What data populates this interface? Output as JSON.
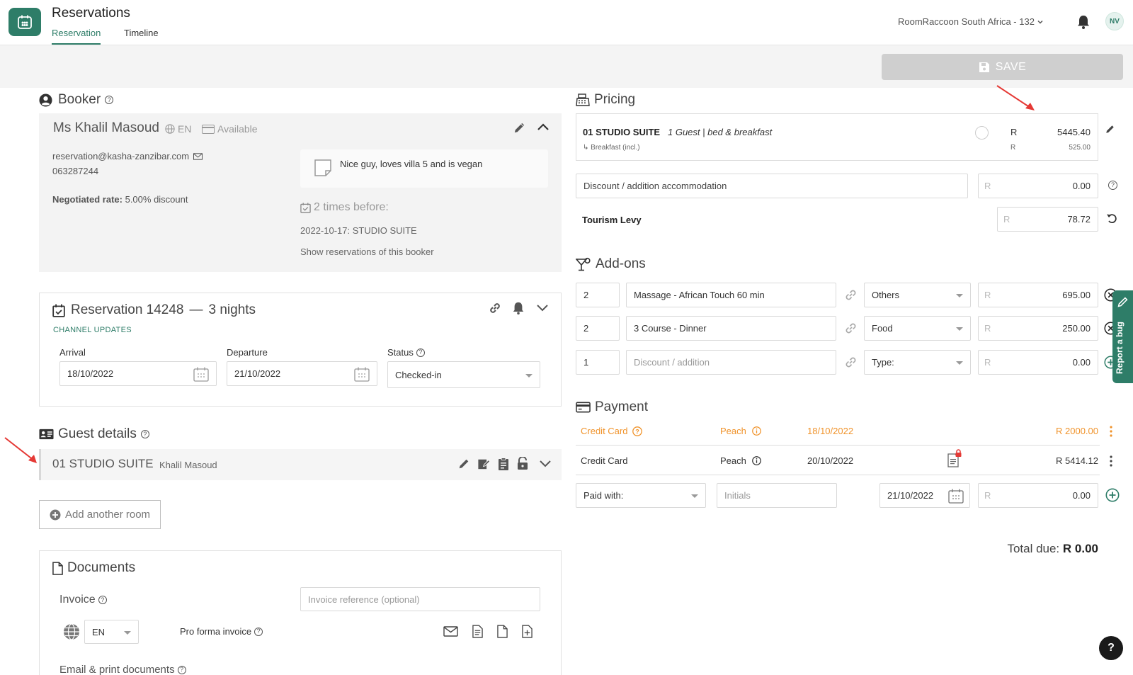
{
  "header": {
    "app_title": "Reservations",
    "tabs": [
      "Reservation",
      "Timeline"
    ],
    "property": "RoomRaccoon South Africa - 132",
    "avatar_initials": "NV"
  },
  "toolbar": {
    "save_label": "SAVE"
  },
  "booker": {
    "section_title": "Booker",
    "name": "Ms Khalil Masoud",
    "language": "EN",
    "availability": "Available",
    "email": "reservation@kasha-zanzibar.com",
    "phone": "063287244",
    "negotiated_label": "Negotiated rate:",
    "negotiated_value": "5.00% discount",
    "note": "Nice guy, loves villa 5 and is vegan",
    "times_before": "2 times before:",
    "history_item": "2022-10-17: STUDIO SUITE",
    "show_link": "Show reservations of this booker"
  },
  "reservation": {
    "title": "Reservation 14248",
    "separator": "—",
    "nights": "3 nights",
    "channel_updates": "CHANNEL UPDATES",
    "arrival_label": "Arrival",
    "arrival_value": "18/10/2022",
    "departure_label": "Departure",
    "departure_value": "21/10/2022",
    "status_label": "Status",
    "status_value": "Checked-in"
  },
  "guest_details": {
    "section_title": "Guest details",
    "room": "01 STUDIO SUITE",
    "guest": "Khalil Masoud",
    "add_room": "Add another room"
  },
  "documents": {
    "section_title": "Documents",
    "invoice_label": "Invoice",
    "invoice_placeholder": "Invoice reference (optional)",
    "language": "EN",
    "pro_forma": "Pro forma invoice",
    "email_print": "Email & print documents"
  },
  "pricing": {
    "section_title": "Pricing",
    "room": "01 STUDIO SUITE",
    "room_desc": "1 Guest | bed & breakfast",
    "currency": "R",
    "room_price": "5445.40",
    "breakfast_label": "↳ Breakfast (incl.)",
    "breakfast_price": "525.00",
    "discount_placeholder": "Discount / addition accommodation",
    "discount_value": "0.00",
    "tourism_levy_label": "Tourism Levy",
    "tourism_levy_value": "78.72"
  },
  "addons": {
    "section_title": "Add-ons",
    "rows": [
      {
        "qty": "2",
        "name": "Massage - African Touch 60 min",
        "type": "Others",
        "price": "695.00"
      },
      {
        "qty": "2",
        "name": "3 Course - Dinner",
        "type": "Food",
        "price": "250.00"
      },
      {
        "qty": "1",
        "name_placeholder": "Discount / addition",
        "type": "Type:",
        "price": "0.00"
      }
    ]
  },
  "payment": {
    "section_title": "Payment",
    "rows": [
      {
        "method": "Credit Card",
        "provider": "Peach",
        "date": "18/10/2022",
        "amount": "R 2000.00",
        "color": "#f0932b"
      },
      {
        "method": "Credit Card",
        "provider": "Peach",
        "date": "20/10/2022",
        "amount": "R 5414.12",
        "color": "#333333"
      }
    ],
    "paid_with": "Paid with:",
    "initials_placeholder": "Initials",
    "new_date": "21/10/2022",
    "new_amount": "0.00",
    "total_label": "Total due:",
    "total_value": "R 0.00"
  },
  "report_bug": "Report a bug",
  "help_fab": "?",
  "colors": {
    "accent": "#2e7d68",
    "warning": "#f0932b",
    "annotation": "#e53935"
  }
}
